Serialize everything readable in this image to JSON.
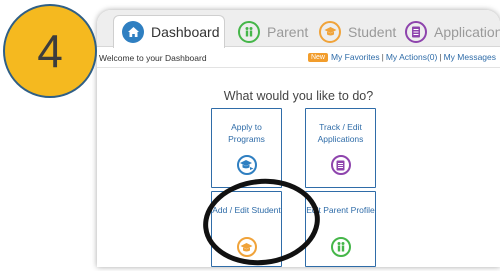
{
  "step": {
    "number": "4"
  },
  "tabs": [
    {
      "label": "Dashboard",
      "icon": "home-icon",
      "color": "#2f7fc1",
      "active": true
    },
    {
      "label": "Parent",
      "icon": "parent-icon",
      "color": "#45b649",
      "active": false
    },
    {
      "label": "Student",
      "icon": "graduation-cap-icon",
      "color": "#f0a33a",
      "active": false
    },
    {
      "label": "Application",
      "icon": "document-icon",
      "color": "#8e44ad",
      "active": false
    }
  ],
  "header": {
    "welcome": "Welcome to your Dashboard",
    "new_badge": "New",
    "links": [
      "My Favorites",
      "My Actions(0)",
      "My Messages"
    ],
    "separator": "|"
  },
  "main": {
    "question": "What would you like to do?",
    "cards": [
      {
        "title": "Apply to Programs",
        "icon": "apply-programs-icon",
        "color": "#2f7fc1"
      },
      {
        "title": "Track / Edit Applications",
        "icon": "document-icon",
        "color": "#8e44ad"
      },
      {
        "title": "Add / Edit Student",
        "icon": "graduation-cap-icon",
        "color": "#f0a33a"
      },
      {
        "title": "Edit Parent Profile",
        "icon": "parent-icon",
        "color": "#45b649"
      }
    ]
  },
  "colors": {
    "accent": "#2f6ca8",
    "badge": "#f5b91f",
    "new_badge": "#f29d2c"
  }
}
